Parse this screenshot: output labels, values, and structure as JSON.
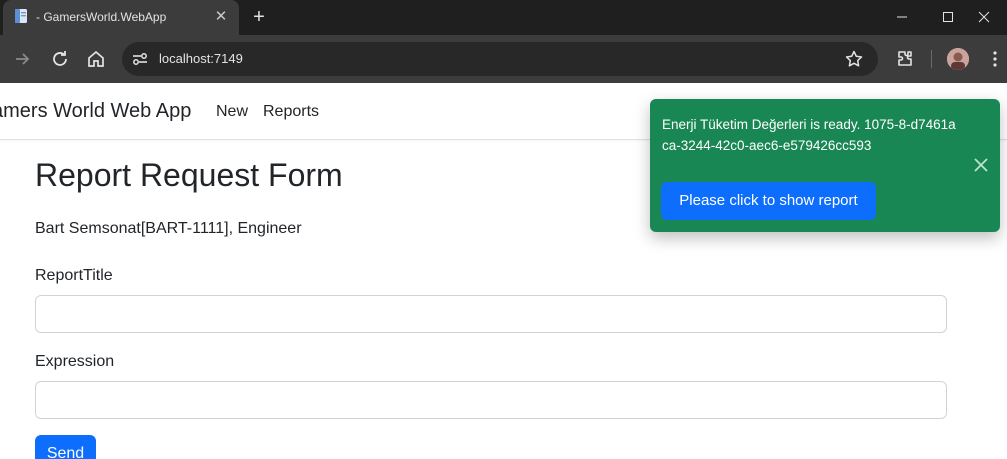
{
  "browser": {
    "tab_title": "- GamersWorld.WebApp",
    "new_tab_symbol": "+",
    "close_symbol": "✕",
    "url": "localhost:7149",
    "icons": [
      "page-favicon-icon",
      "close-icon",
      "plus-icon",
      "minimize-icon",
      "maximize-icon",
      "close-window-icon",
      "forward-icon",
      "reload-icon",
      "home-icon",
      "site-info-icon",
      "star-icon",
      "extensions-icon",
      "avatar",
      "more-vert-icon"
    ]
  },
  "navbar": {
    "brand": "amers World Web App",
    "links": [
      "New",
      "Reports"
    ]
  },
  "main": {
    "title": "Report Request Form",
    "user_line": "Bart Semsonat[BART-1111], Engineer",
    "fields": [
      {
        "label": "ReportTitle",
        "value": ""
      },
      {
        "label": "Expression",
        "value": ""
      }
    ],
    "send_label": "Send"
  },
  "toast": {
    "message": "Enerji Tüketim Değerleri is ready. 1075-8-d7461aca-3244-42c0-aec6-e579426cc593",
    "button_label": "Please click to show report",
    "background": "#198754"
  },
  "colors": {
    "accent": "#0d6efd",
    "toast": "#198754",
    "chrome_dark": "#1f1f1f",
    "chrome_toolbar": "#3c3c3c"
  }
}
